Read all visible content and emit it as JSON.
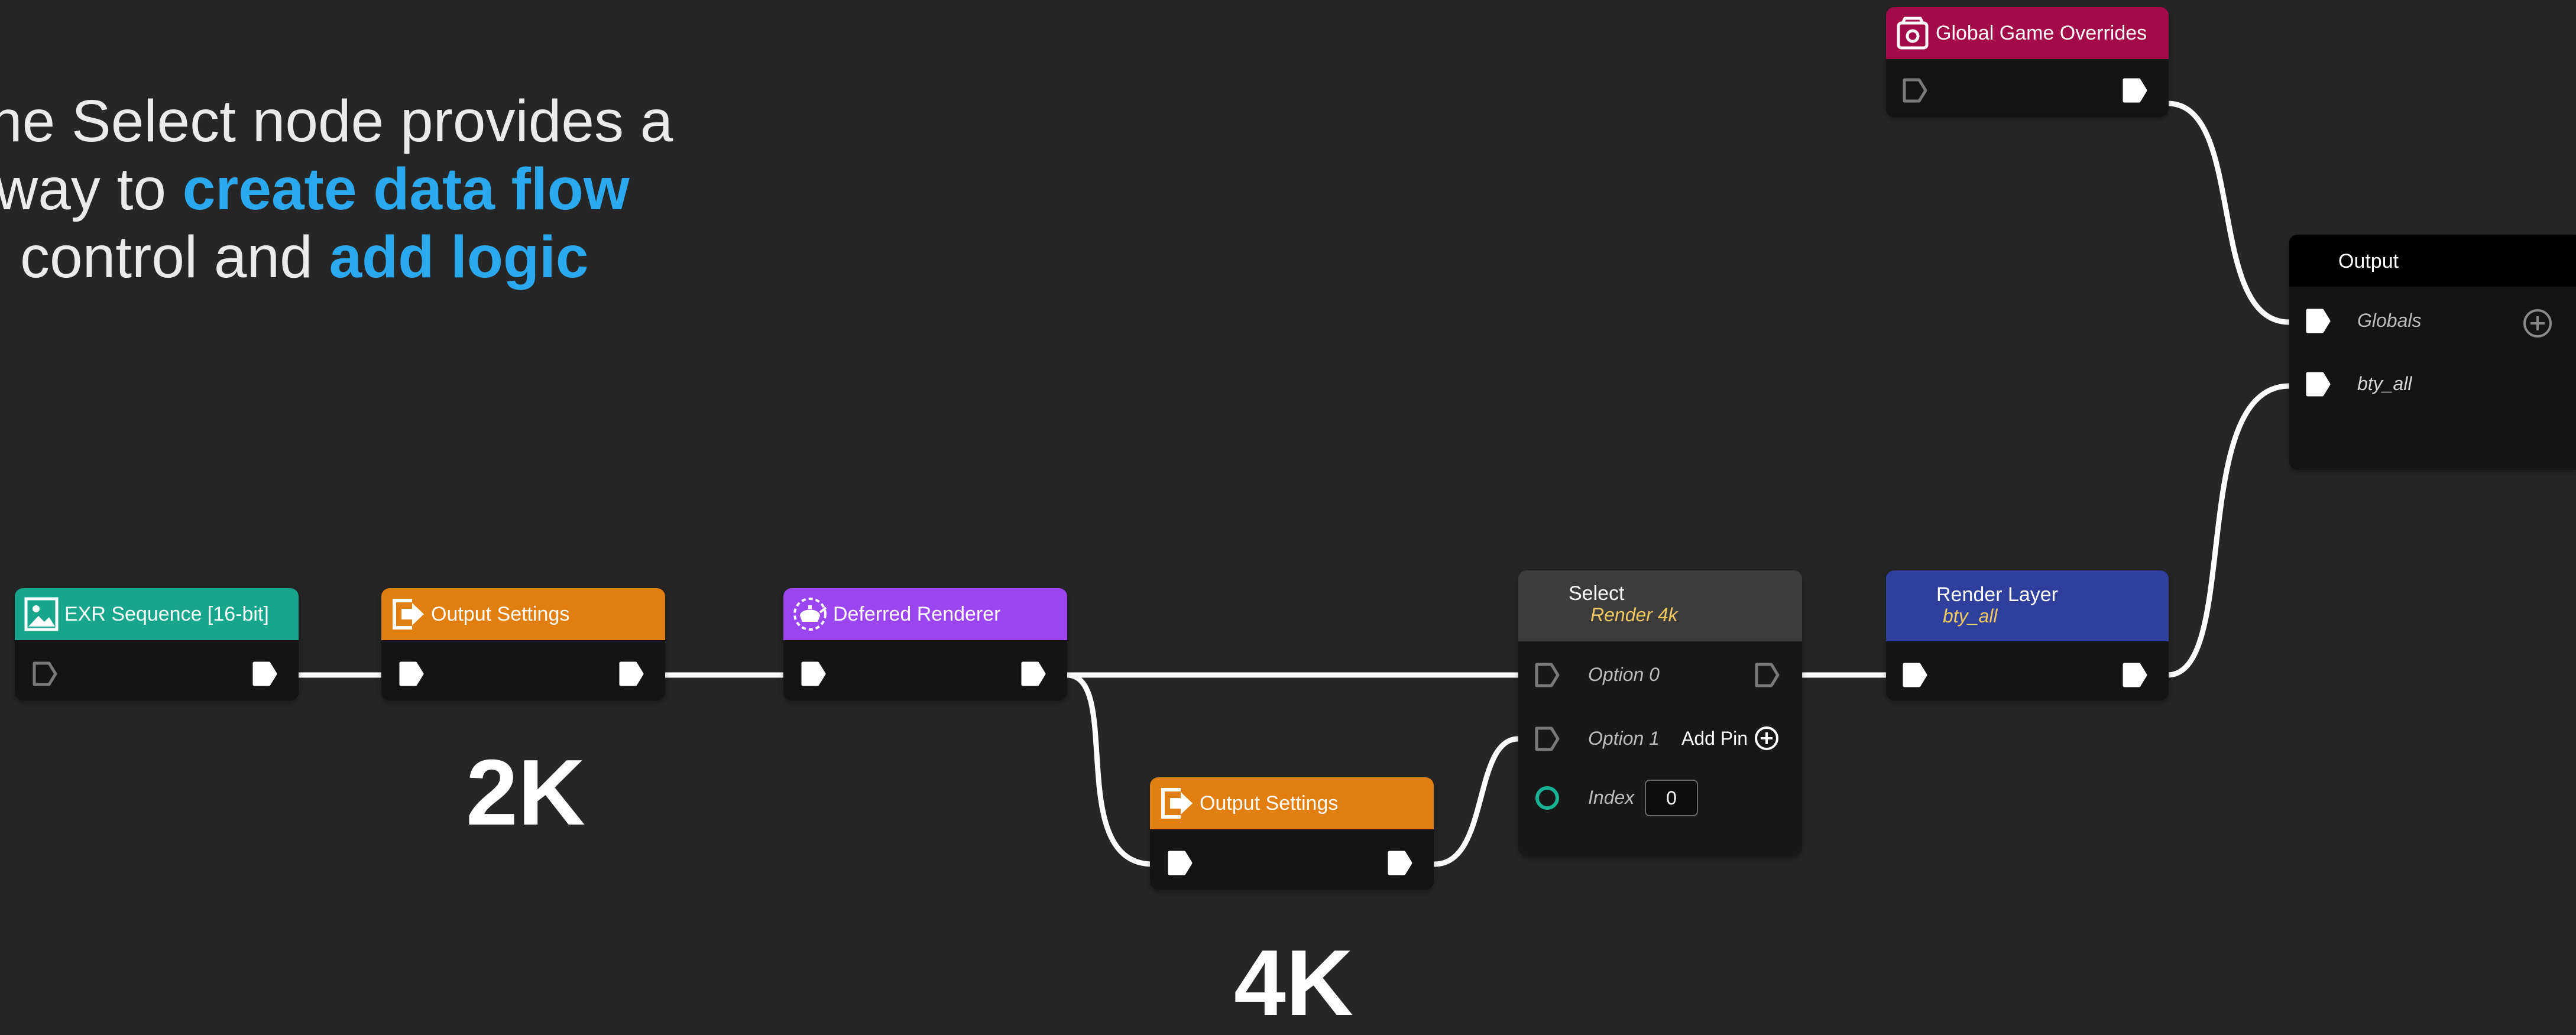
{
  "intro": {
    "line1": "he Select node provides a",
    "line2_prefix": "way to ",
    "line2_highlight": "create data flow",
    "line3_prefix": "control and ",
    "line3_highlight": "add logic"
  },
  "labels": {
    "res_2k": "2K",
    "res_4k": "4K"
  },
  "nodes": {
    "exr": {
      "title": "EXR Sequence [16-bit]",
      "color": "#17a58b",
      "icon": "image-icon"
    },
    "output_settings_2k": {
      "title": "Output Settings",
      "color": "#e07f10",
      "icon": "output-settings-icon"
    },
    "deferred": {
      "title": "Deferred Renderer",
      "color": "#9b45f0",
      "icon": "teapot-icon"
    },
    "output_settings_4k": {
      "title": "Output Settings",
      "color": "#e07f10",
      "icon": "output-settings-icon"
    },
    "select": {
      "title": "Select",
      "subtitle": "Render 4k",
      "color": "#3c3c3c",
      "option0": "Option 0",
      "option1": "Option 1",
      "add_pin": "Add Pin",
      "index_label": "Index",
      "index_value": "0"
    },
    "render_layer": {
      "title": "Render Layer",
      "subtitle": "bty_all",
      "color": "#2f3f9c"
    },
    "globals": {
      "title": "Global Game Overrides",
      "color": "#a20b48",
      "icon": "globals-icon"
    },
    "output": {
      "title": "Output",
      "color": "#000000",
      "pin_globals": "Globals",
      "pin_bty": "bty_all"
    }
  }
}
